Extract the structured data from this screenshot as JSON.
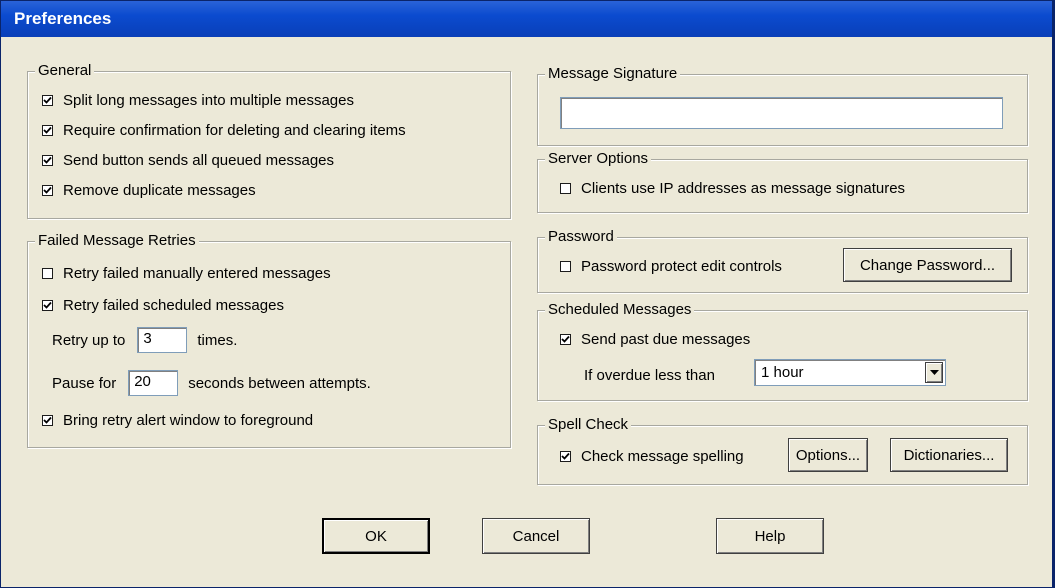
{
  "window": {
    "title": "Preferences"
  },
  "general": {
    "legend": "General",
    "items": [
      {
        "label": "Split long messages into multiple messages",
        "checked": true
      },
      {
        "label": "Require confirmation for deleting and clearing items",
        "checked": true
      },
      {
        "label": "Send button sends all queued messages",
        "checked": true
      },
      {
        "label": "Remove duplicate messages",
        "checked": true
      }
    ]
  },
  "retries": {
    "legend": "Failed Message Retries",
    "manual": {
      "label": "Retry failed manually entered messages",
      "checked": false
    },
    "scheduled": {
      "label": "Retry failed scheduled messages",
      "checked": true
    },
    "retry_prefix": "Retry up to",
    "retry_value": "3",
    "retry_suffix": "times.",
    "pause_prefix": "Pause for",
    "pause_value": "20",
    "pause_suffix": "seconds between attempts.",
    "foreground": {
      "label": "Bring retry alert window to foreground",
      "checked": true
    }
  },
  "signature": {
    "legend": "Message Signature",
    "value": ""
  },
  "server": {
    "legend": "Server Options",
    "ip": {
      "label": "Clients use IP addresses as message signatures",
      "checked": false
    }
  },
  "password": {
    "legend": "Password",
    "protect": {
      "label": "Password protect edit controls",
      "checked": false
    },
    "change_label": "Change Password..."
  },
  "scheduled": {
    "legend": "Scheduled Messages",
    "past_due": {
      "label": "Send past due messages",
      "checked": true
    },
    "overdue_label": "If overdue less than",
    "overdue_value": "1 hour"
  },
  "spell": {
    "legend": "Spell Check",
    "check": {
      "label": "Check message spelling",
      "checked": true
    },
    "options_label": "Options...",
    "dictionaries_label": "Dictionaries..."
  },
  "footer": {
    "ok_label": "OK",
    "cancel_label": "Cancel",
    "help_label": "Help"
  }
}
